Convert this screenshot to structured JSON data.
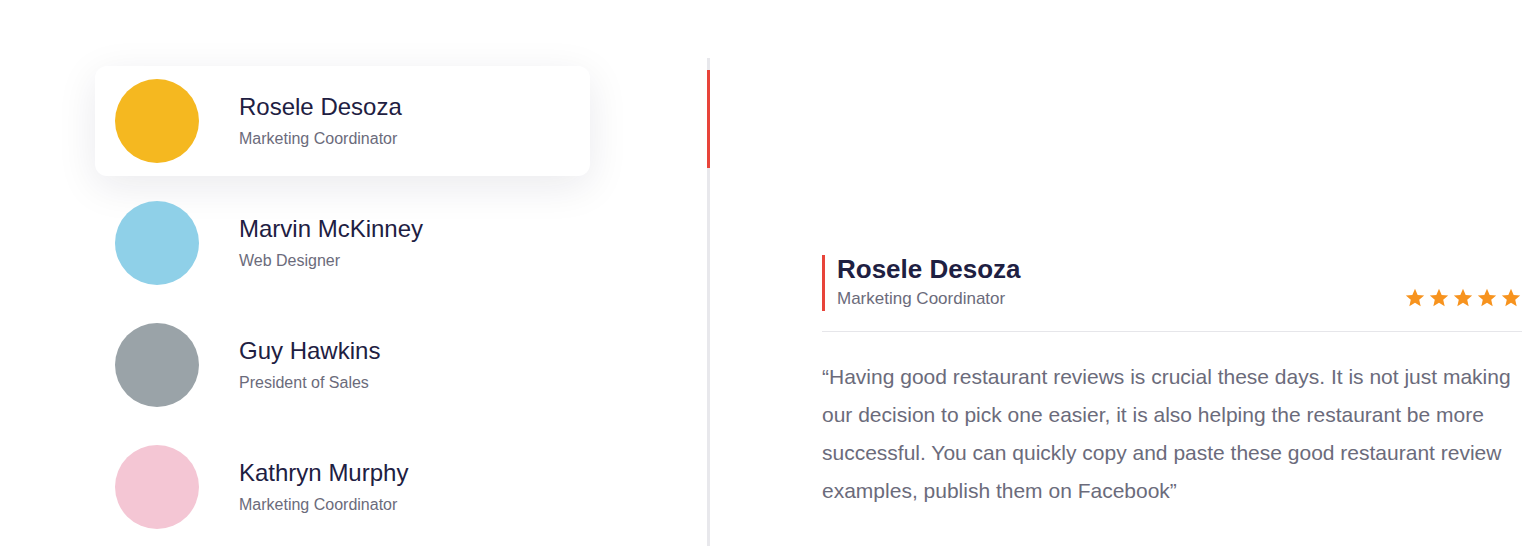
{
  "people": [
    {
      "name": "Rosele Desoza",
      "role": "Marketing Coordinator",
      "selected": true,
      "color": "#f5b820"
    },
    {
      "name": "Marvin McKinney",
      "role": "Web Designer",
      "selected": false,
      "color": "#8fd0e8"
    },
    {
      "name": "Guy Hawkins",
      "role": "President of Sales",
      "selected": false,
      "color": "#9aa3a8"
    },
    {
      "name": "Kathryn Murphy",
      "role": "Marketing Coordinator",
      "selected": false,
      "color": "#f4c6d4"
    }
  ],
  "review": {
    "name": "Rosele Desoza",
    "role": "Marketing Coordinator",
    "stars": 5,
    "quote": "“Having good restaurant reviews is crucial these days. It is not just making our decision to pick one easier, it is also helping the restaurant be more successful. You can quickly copy and paste these good restaurant review examples, publish them on Facebook”"
  }
}
